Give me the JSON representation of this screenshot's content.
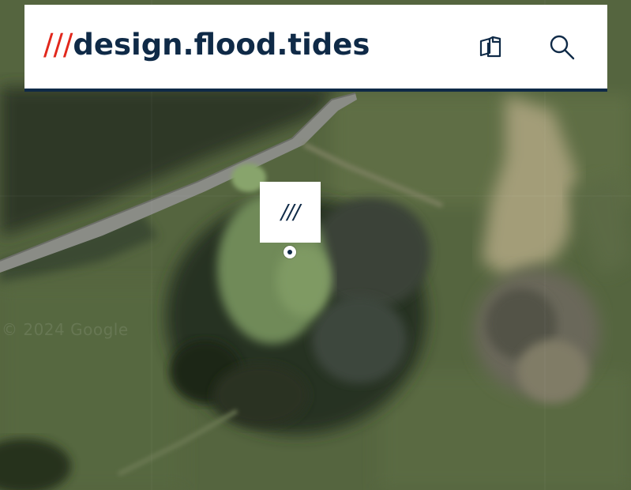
{
  "header": {
    "slashes": "///",
    "words": "design.flood.tides",
    "copy_icon": "copy-icon",
    "search_icon": "search-icon"
  },
  "map": {
    "pin_label": "///",
    "watermark": "© 2024 Google",
    "type": "satellite"
  },
  "colors": {
    "brand_red": "#e1271c",
    "navy": "#0f2a47",
    "header_bg": "#ffffff"
  }
}
